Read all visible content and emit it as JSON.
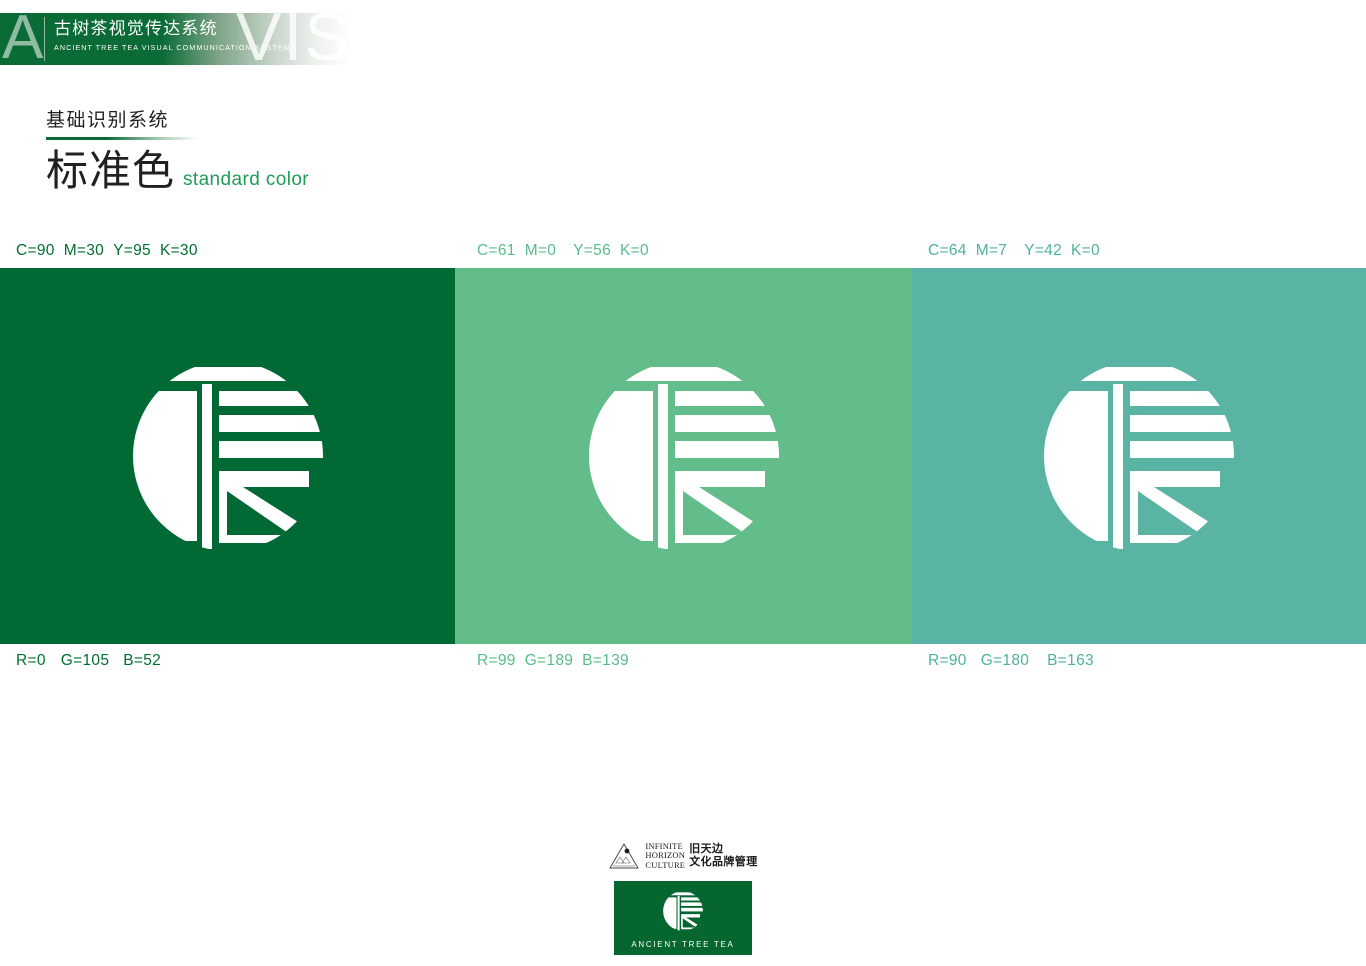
{
  "header": {
    "letter_mark": "A",
    "watermark": "VIS",
    "title_cn": "古树茶视觉传达系统",
    "title_en": "ANCIENT TREE TEA VISUAL COMMUNICATION SYSTEM"
  },
  "title": {
    "section_cn": "基础识别系统",
    "heading_cn": "标准色",
    "heading_en": "standard color"
  },
  "colors": {
    "dark_green": "#006934",
    "medium_green": "#63bd8b",
    "teal_green": "#5ab4a3",
    "accent_text_green": "#1f9d56",
    "badge_green": "#056630"
  },
  "swatches": [
    {
      "name": "dark-green",
      "hex": "#006934",
      "cmyk": {
        "c": "C=90",
        "m": "M=30",
        "y": "Y=95",
        "k": "K=30"
      },
      "rgb": {
        "r": "R=0",
        "g": "G=105",
        "b": "B=52"
      },
      "label_color": "#00702f"
    },
    {
      "name": "medium-green",
      "hex": "#63bd8b",
      "cmyk": {
        "c": "C=61",
        "m": "M=0",
        "y": "Y=56",
        "k": "K=0"
      },
      "rgb": {
        "r": "R=99",
        "g": "G=189",
        "b": "B=139"
      },
      "label_color": "#58bc8a"
    },
    {
      "name": "teal-green",
      "hex": "#5ab4a3",
      "cmyk": {
        "c": "C=64",
        "m": "M=7",
        "y": "Y=42",
        "k": "K=0"
      },
      "rgb": {
        "r": "R=90",
        "g": "G=180",
        "b": "B=163"
      },
      "label_color": "#4fb0a0"
    }
  ],
  "footer": {
    "mark_en_line1": "INFINITE",
    "mark_en_line2": "HORIZON",
    "mark_en_line3": "CULTURE",
    "mark_cn_line1": "旧天边",
    "mark_cn_line2": "文化品牌管理",
    "badge_text": "ANCIENT TREE TEA"
  }
}
